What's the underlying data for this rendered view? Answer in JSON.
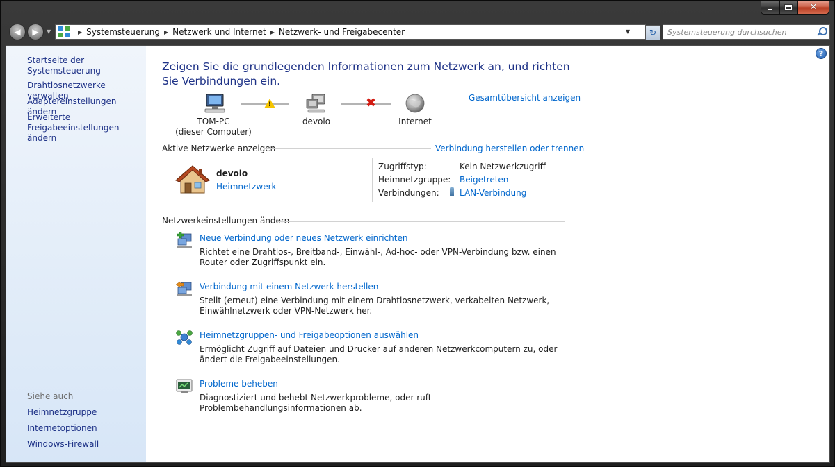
{
  "window": {
    "caption_close": "✕"
  },
  "navigation": {
    "breadcrumbs": [
      "Systemsteuerung",
      "Netzwerk und Internet",
      "Netzwerk- und Freigabecenter"
    ],
    "search_placeholder": "Systemsteuerung durchsuchen"
  },
  "sidebar": {
    "items": [
      "Startseite der Systemsteuerung",
      "Drahtlosnetzwerke verwalten",
      "Adaptereinstellungen ändern",
      "Erweiterte Freigabeeinstellungen ändern"
    ],
    "see_also_heading": "Siehe auch",
    "see_also": [
      "Heimnetzgruppe",
      "Internetoptionen",
      "Windows-Firewall"
    ]
  },
  "main": {
    "title": "Zeigen Sie die grundlegenden Informationen zum Netzwerk an, und richten Sie Verbindungen ein.",
    "overview_link": "Gesamtübersicht anzeigen",
    "map": {
      "computer_name": "TOM-PC",
      "computer_sub": "(dieser Computer)",
      "network_name": "devolo",
      "internet_label": "Internet"
    },
    "active_networks": {
      "heading": "Aktive Netzwerke anzeigen",
      "connect_link": "Verbindung herstellen oder trennen",
      "network_name": "devolo",
      "network_type": "Heimnetzwerk",
      "access_type_label": "Zugriffstyp:",
      "access_type_value": "Kein Netzwerkzugriff",
      "homegroup_label": "Heimnetzgruppe:",
      "homegroup_value": "Beigetreten",
      "connections_label": "Verbindungen:",
      "connections_value": "LAN-Verbindung"
    },
    "settings": {
      "heading": "Netzwerkeinstellungen ändern",
      "tasks": [
        {
          "title": "Neue Verbindung oder neues Netzwerk einrichten",
          "desc": "Richtet eine Drahtlos-, Breitband-, Einwähl-, Ad-hoc- oder VPN-Verbindung bzw. einen Router oder Zugriffspunkt ein."
        },
        {
          "title": "Verbindung mit einem Netzwerk herstellen",
          "desc": "Stellt (erneut) eine Verbindung mit einem Drahtlosnetzwerk, verkabelten Netzwerk, Einwählnetzwerk oder VPN-Netzwerk her."
        },
        {
          "title": "Heimnetzgruppen- und Freigabeoptionen auswählen",
          "desc": "Ermöglicht Zugriff auf Dateien und Drucker auf anderen Netzwerkcomputern zu, oder ändert die Freigabeeinstellungen."
        },
        {
          "title": "Probleme beheben",
          "desc": "Diagnostiziert und behebt Netzwerkprobleme, oder ruft Problembehandlungsinformationen ab."
        }
      ]
    }
  }
}
